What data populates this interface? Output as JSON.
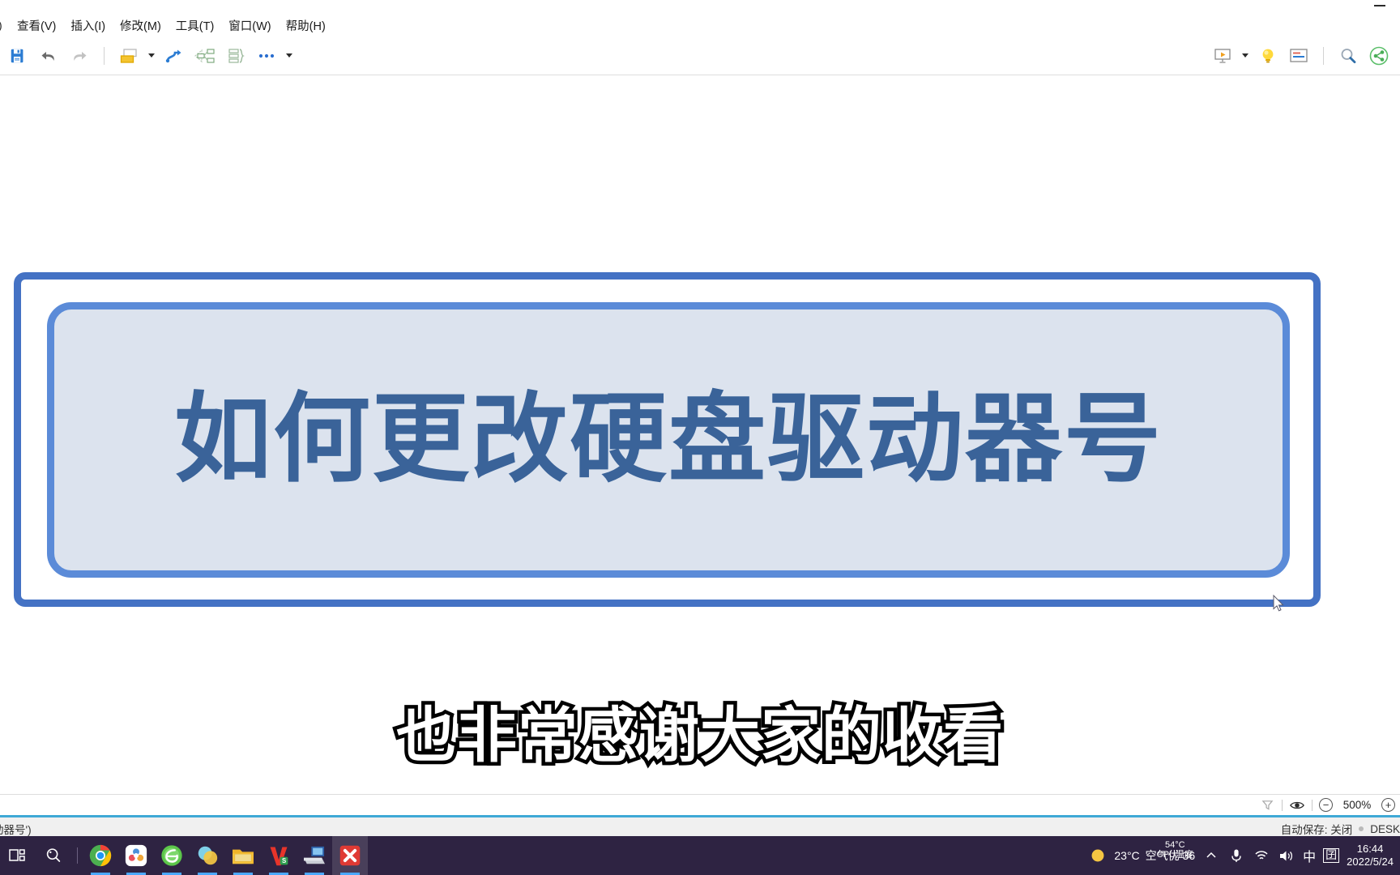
{
  "window": {
    "minimize_label": "—"
  },
  "menubar": {
    "items": [
      {
        "label": "查看(V)",
        "name": "menu-view"
      },
      {
        "label": "插入(I)",
        "name": "menu-insert"
      },
      {
        "label": "修改(M)",
        "name": "menu-modify"
      },
      {
        "label": "工具(T)",
        "name": "menu-tools"
      },
      {
        "label": "窗口(W)",
        "name": "menu-window"
      },
      {
        "label": "帮助(H)",
        "name": "menu-help"
      }
    ]
  },
  "toolbar": {
    "left_icons": [
      {
        "name": "save-icon",
        "title": "保存"
      },
      {
        "name": "undo-icon",
        "title": "撤销"
      },
      {
        "name": "redo-icon",
        "title": "恢复"
      },
      {
        "name": "new-slide-icon",
        "title": "新建幻灯片"
      },
      {
        "name": "new-slide-dropdown-caret",
        "title": "更多版式"
      },
      {
        "name": "transition-icon",
        "title": "切换"
      },
      {
        "name": "smartart-icon",
        "title": "智能图形"
      },
      {
        "name": "outline-icon",
        "title": "大纲"
      },
      {
        "name": "more-icon",
        "title": "更多"
      },
      {
        "name": "more-dropdown-caret",
        "title": "更多命令"
      }
    ],
    "right_icons": [
      {
        "name": "slideshow-icon",
        "title": "放映"
      },
      {
        "name": "slideshow-dropdown-caret",
        "title": "放映设置"
      },
      {
        "name": "lightbulb-icon",
        "title": "灵感"
      },
      {
        "name": "presenter-notes-icon",
        "title": "演讲备注"
      },
      {
        "name": "search-icon",
        "title": "查找"
      },
      {
        "name": "share-icon",
        "title": "分享"
      }
    ]
  },
  "slide": {
    "title": "如何更改硬盘驱动器号",
    "title_color": "#3a6399",
    "fill_color": "#dce3ee",
    "outer_border_color": "#4472c4",
    "inner_border_color": "#5b8bd8"
  },
  "caption": {
    "text": "也非常感谢大家的收看",
    "fill_color": "#ffffff",
    "stroke_color": "#000000"
  },
  "statusbar": {
    "filter_icon": "filter-icon",
    "eye_icon": "eye-icon",
    "zoom_out_label": "−",
    "zoom_level": "500%",
    "zoom_in_label": "+"
  },
  "status_row2": {
    "left_text": "盘驱动器号')",
    "autosave_text": "自动保存: 关闭",
    "device_text": "DESK"
  },
  "taskbar": {
    "left_icons": [
      {
        "name": "task-view-icon",
        "title": "任务视图"
      },
      {
        "name": "search-icon",
        "title": "搜索"
      }
    ],
    "apps": [
      {
        "name": "taskbar-app-chrome",
        "title": "Google Chrome",
        "running": true
      },
      {
        "name": "taskbar-app-cloud-notes",
        "title": "笔记",
        "running": true
      },
      {
        "name": "taskbar-app-360-browser",
        "title": "360浏览器",
        "running": true
      },
      {
        "name": "taskbar-app-bubbles",
        "title": "应用",
        "running": true
      },
      {
        "name": "taskbar-app-file-explorer",
        "title": "文件资源管理器",
        "running": true
      },
      {
        "name": "taskbar-app-wps",
        "title": "WPS",
        "running": true
      },
      {
        "name": "taskbar-app-scanner",
        "title": "扫描仪",
        "running": true
      },
      {
        "name": "taskbar-app-xmind",
        "title": "红色应用",
        "running": true
      }
    ],
    "tray": {
      "weather_temp": "23°C",
      "weather_air": "空气优 36",
      "cpu_label": "54°C",
      "cpu_sub": "CPU温度",
      "chevron_icon": "chevron-up-icon",
      "mic_icon": "microphone-icon",
      "wifi_icon": "wifi-icon",
      "volume_icon": "speaker-icon",
      "ime_label": "中",
      "ime_box_label": "囝",
      "time": "16:44",
      "date": "2022/5/24"
    }
  }
}
